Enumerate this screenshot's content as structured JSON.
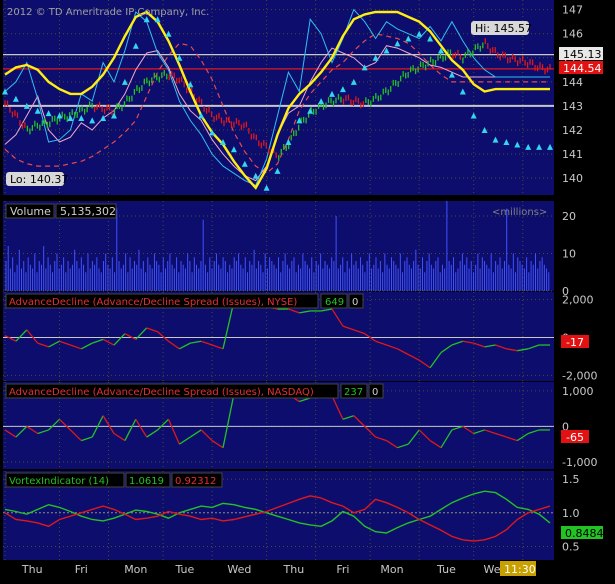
{
  "header": {
    "copyright": "2012 © TD Ameritrade IP Company, Inc."
  },
  "colors": {
    "panel_bg": "#0d0d6e",
    "grid": "#4a4a30",
    "price_up": "#22c322",
    "price_down": "#e01818",
    "markers": "#33d6ee",
    "band": "#e84a4a",
    "ma_yellow": "#ffee11",
    "cyan_line": "#30c0ee",
    "pink_line": "#f0a8c8",
    "volume": "#3f52ff",
    "hline": "#c8c8c8"
  },
  "x_axis": {
    "labels": [
      "Thu",
      "Fri",
      "Mon",
      "Tue",
      "Wed",
      "Thu",
      "Fri",
      "Mon",
      "Tue",
      "Wed"
    ],
    "current_time": "11:30"
  },
  "chart_data": [
    {
      "type": "line",
      "panel": "price",
      "y_ticks": [
        140,
        141,
        142,
        143,
        144,
        145,
        146,
        147
      ],
      "ylim": [
        139.3,
        147.4
      ],
      "annotations": {
        "high_label": "Hi: 145.57",
        "low_label": "Lo: 140.37",
        "last_price": "144.54",
        "marker_price": "145.13"
      },
      "reference_lines": [
        145.13,
        144.54,
        143.0
      ],
      "x": [
        0,
        2,
        4,
        6,
        8,
        10,
        12,
        14,
        16,
        18,
        20,
        22,
        24,
        26,
        28,
        30,
        32,
        34,
        36,
        38,
        40,
        42,
        44,
        46,
        48,
        50,
        52,
        54,
        56,
        58,
        60,
        62,
        64,
        66,
        68,
        70,
        72,
        74,
        76,
        78,
        80,
        82,
        84,
        86,
        88,
        90,
        92,
        94,
        96,
        98,
        100
      ],
      "series": [
        {
          "role": "price",
          "values": [
            143.1,
            142.6,
            142.0,
            142.2,
            142.3,
            142.5,
            142.6,
            142.8,
            143.0,
            142.9,
            142.8,
            143.1,
            143.6,
            144.0,
            144.2,
            144.3,
            144.1,
            143.6,
            143.1,
            142.6,
            142.4,
            142.3,
            142.2,
            141.6,
            141.3,
            140.9,
            141.4,
            142.2,
            142.7,
            143.0,
            143.2,
            143.3,
            143.2,
            143.1,
            143.3,
            143.6,
            144.0,
            144.4,
            144.6,
            144.8,
            145.0,
            145.2,
            145.0,
            145.3,
            145.6,
            145.2,
            145.0,
            144.9,
            144.8,
            144.6,
            144.5
          ]
        },
        {
          "role": "marker_upper",
          "values": [
            143.6,
            143.3,
            143.0,
            142.8,
            142.7,
            142.6,
            142.5,
            142.5,
            142.4,
            142.5,
            142.6,
            144.0,
            145.5,
            146.6,
            146.6,
            146.0,
            145.0,
            143.9,
            142.6,
            141.9,
            141.5,
            141.2,
            140.6,
            140.1,
            139.6,
            140.3,
            141.5,
            142.4,
            142.8,
            143.2,
            143.5,
            143.7,
            144.0,
            144.6,
            145.0,
            145.3,
            145.6,
            145.8,
            146.0,
            145.8,
            145.3,
            144.3,
            143.6,
            142.6,
            142.0,
            141.6,
            141.5,
            141.4,
            141.3,
            141.3,
            141.3
          ]
        },
        {
          "role": "yellow_line",
          "values": [
            144.3,
            144.6,
            144.7,
            144.5,
            144.0,
            143.7,
            143.5,
            143.5,
            143.8,
            144.3,
            145.0,
            145.9,
            146.7,
            146.9,
            146.5,
            145.7,
            144.7,
            143.6,
            142.6,
            141.9,
            141.4,
            140.7,
            140.1,
            139.6,
            140.4,
            141.8,
            142.9,
            143.5,
            143.9,
            144.4,
            145.0,
            145.9,
            146.6,
            146.8,
            146.9,
            146.9,
            146.9,
            146.7,
            146.5,
            146.1,
            145.5,
            144.9,
            144.5,
            143.9,
            143.6,
            143.7,
            143.7,
            143.7,
            143.7,
            143.7,
            143.7
          ]
        },
        {
          "role": "cyan_line",
          "values": [
            143.6,
            144.0,
            144.8,
            143.3,
            141.5,
            141.6,
            142.0,
            143.5,
            143.2,
            144.8,
            144.0,
            145.3,
            146.9,
            146.5,
            145.2,
            144.5,
            143.2,
            142.4,
            141.8,
            141.0,
            140.5,
            140.2,
            139.9,
            139.7,
            140.8,
            142.6,
            144.4,
            143.6,
            146.6,
            146.0,
            144.8,
            145.8,
            147.0,
            146.5,
            145.8,
            146.5,
            146.2,
            146.0,
            145.8,
            146.3,
            145.7,
            146.5,
            145.7,
            145.0,
            144.5,
            144.2,
            144.2,
            144.2,
            144.2,
            144.2,
            144.2
          ]
        },
        {
          "role": "pink_line",
          "values": [
            141.4,
            141.8,
            142.6,
            143.4,
            142.0,
            141.5,
            141.7,
            142.3,
            142.0,
            142.5,
            142.8,
            143.5,
            144.5,
            145.2,
            145.3,
            144.6,
            143.5,
            142.8,
            142.4,
            141.6,
            141.0,
            140.5,
            140.1,
            139.9,
            140.5,
            141.8,
            142.7,
            143.0,
            144.0,
            144.8,
            145.4,
            145.2,
            145.0,
            144.6,
            144.8,
            145.5,
            145.4,
            145.2,
            145.0,
            144.7,
            144.6,
            144.4,
            144.2,
            144.2,
            144.2,
            144.2,
            144.2,
            144.2,
            144.2,
            144.2,
            144.2
          ]
        },
        {
          "role": "red_dashed_band",
          "values": [
            141.2,
            140.8,
            140.6,
            140.5,
            140.5,
            140.5,
            140.6,
            140.7,
            140.9,
            141.2,
            141.5,
            141.9,
            142.4,
            143.4,
            144.4,
            145.1,
            145.6,
            145.5,
            144.9,
            144.1,
            143.0,
            141.9,
            141.1,
            140.5,
            140.2,
            140.6,
            141.6,
            142.8,
            143.5,
            144.0,
            144.5,
            144.8,
            145.3,
            145.7,
            146.0,
            145.9,
            145.8,
            145.6,
            145.2,
            144.7,
            144.3,
            144.0,
            144.0,
            144.0,
            144.0,
            144.0,
            144.0,
            144.0,
            144.0,
            144.0,
            144.0
          ]
        }
      ]
    },
    {
      "type": "bar",
      "panel": "volume",
      "title": "Volume",
      "current_value": "5,135,302",
      "unit_label": "<millions>",
      "y_ticks": [
        0,
        10,
        20
      ],
      "ylim": [
        0,
        24
      ],
      "values": [
        8,
        12,
        6,
        9,
        5,
        7,
        11,
        6,
        8,
        5,
        9,
        7,
        6,
        10,
        5,
        8,
        7,
        12,
        6,
        9,
        7,
        5,
        8,
        10,
        6,
        7,
        9,
        5,
        8,
        6,
        7,
        11,
        8,
        6,
        9,
        7,
        5,
        10,
        6,
        8,
        7,
        9,
        6,
        5,
        8,
        10,
        7,
        6,
        9,
        5,
        22,
        8,
        6,
        7,
        10,
        5,
        9,
        6,
        8,
        7,
        11,
        6,
        8,
        5,
        9,
        7,
        6,
        10,
        8,
        7,
        5,
        9,
        6,
        8,
        10,
        7,
        6,
        9,
        5,
        8,
        7,
        6,
        10,
        8,
        5,
        9,
        7,
        6,
        8,
        19,
        7,
        5,
        9,
        6,
        8,
        10,
        7,
        6,
        9,
        8,
        5,
        7,
        6,
        9,
        8,
        10,
        7,
        6,
        9,
        5,
        8,
        7,
        11,
        6,
        8,
        7,
        5,
        10,
        6,
        9,
        8,
        7,
        6,
        9,
        5,
        8,
        10,
        7,
        6,
        8,
        9,
        5,
        7,
        6,
        10,
        8,
        7,
        6,
        9,
        5,
        8,
        7,
        10,
        6,
        8,
        7,
        6,
        9,
        8,
        20,
        6,
        7,
        9,
        5,
        8,
        6,
        10,
        7,
        8,
        6,
        9,
        7,
        5,
        8,
        10,
        6,
        7,
        9,
        6,
        8,
        5,
        10,
        7,
        6,
        9,
        8,
        7,
        6,
        10,
        5,
        8,
        9,
        7,
        6,
        8,
        11,
        7,
        6,
        9,
        5,
        8,
        10,
        7,
        6,
        8,
        9,
        5,
        7,
        6,
        24,
        8,
        7,
        9,
        5,
        6,
        8,
        10,
        7,
        9,
        6,
        8,
        5,
        7,
        10,
        6,
        9,
        8,
        7,
        6,
        10,
        5,
        8,
        7,
        9,
        6,
        8,
        22,
        7,
        6,
        10,
        5,
        9,
        8,
        7,
        6,
        9,
        5,
        8,
        7,
        10,
        6,
        8,
        9,
        7,
        6,
        5
      ]
    },
    {
      "type": "line",
      "panel": "nyse",
      "title": "AdvanceDecline (Advance/Decline Spread (Issues), NYSE)",
      "value_a": "649",
      "value_b": "0",
      "last_label": "-17",
      "y_ticks": [
        -2000,
        0,
        2000
      ],
      "ylim": [
        -2300,
        2400
      ],
      "x": [
        0,
        2,
        4,
        6,
        8,
        10,
        12,
        14,
        16,
        18,
        20,
        22,
        24,
        26,
        28,
        30,
        32,
        34,
        36,
        38,
        40,
        42,
        44,
        46,
        48,
        50,
        52,
        54,
        56,
        58,
        60,
        62,
        64,
        66,
        68,
        70,
        72,
        74,
        76,
        78,
        80,
        82,
        84,
        86,
        88,
        90,
        92,
        94,
        96,
        98,
        100
      ],
      "values": [
        100,
        -200,
        400,
        -300,
        -500,
        -200,
        -400,
        -600,
        -300,
        -100,
        -400,
        200,
        -100,
        500,
        300,
        -200,
        -600,
        -300,
        -200,
        -400,
        -600,
        1900,
        2000,
        1700,
        1600,
        1500,
        1500,
        1300,
        1400,
        1400,
        1500,
        600,
        400,
        200,
        -200,
        -400,
        -600,
        -900,
        -1200,
        -1600,
        -800,
        -400,
        -200,
        -300,
        -500,
        -400,
        -600,
        -700,
        -600,
        -400,
        -400
      ]
    },
    {
      "type": "line",
      "panel": "nasdaq",
      "title": "AdvanceDecline (Advance/Decline Spread (Issues), NASDAQ)",
      "value_a": "237",
      "value_b": "0",
      "last_label": "-65",
      "y_ticks": [
        -1000,
        0,
        1000
      ],
      "ylim": [
        -1200,
        1250
      ],
      "x": [
        0,
        2,
        4,
        6,
        8,
        10,
        12,
        14,
        16,
        18,
        20,
        22,
        24,
        26,
        28,
        30,
        32,
        34,
        36,
        38,
        40,
        42,
        44,
        46,
        48,
        50,
        52,
        54,
        56,
        58,
        60,
        62,
        64,
        66,
        68,
        70,
        72,
        74,
        76,
        78,
        80,
        82,
        84,
        86,
        88,
        90,
        92,
        94,
        96,
        98,
        100
      ],
      "values": [
        -100,
        -300,
        0,
        -200,
        -100,
        200,
        -100,
        -400,
        -300,
        300,
        -200,
        -400,
        200,
        -300,
        -100,
        200,
        -500,
        -300,
        -100,
        -400,
        -600,
        900,
        1000,
        950,
        900,
        880,
        900,
        700,
        800,
        900,
        860,
        200,
        300,
        0,
        -300,
        -400,
        -600,
        -500,
        -100,
        -400,
        -600,
        -100,
        0,
        -200,
        -100,
        -200,
        -300,
        -400,
        -200,
        -100,
        -100
      ]
    },
    {
      "type": "line",
      "panel": "vortex",
      "title": "VortexIndicator (14)",
      "vi_plus": "1.0619",
      "vi_minus": "0.92312",
      "last_label": "0.8484",
      "y_ticks": [
        0.5,
        1.0,
        1.5
      ],
      "ylim": [
        0.3,
        1.62
      ],
      "x": [
        0,
        2,
        4,
        6,
        8,
        10,
        12,
        14,
        16,
        18,
        20,
        22,
        24,
        26,
        28,
        30,
        32,
        34,
        36,
        38,
        40,
        42,
        44,
        46,
        48,
        50,
        52,
        54,
        56,
        58,
        60,
        62,
        64,
        66,
        68,
        70,
        72,
        74,
        76,
        78,
        80,
        82,
        84,
        86,
        88,
        90,
        92,
        94,
        96,
        98,
        100
      ],
      "series": [
        {
          "color_key": "price_up",
          "values": [
            1.05,
            1.02,
            0.98,
            1.05,
            1.12,
            1.08,
            1.02,
            0.95,
            0.9,
            0.88,
            0.92,
            0.98,
            1.04,
            1.02,
            0.98,
            0.92,
            1.0,
            1.05,
            1.1,
            1.08,
            1.14,
            1.12,
            1.08,
            1.05,
            1.0,
            0.95,
            0.9,
            0.85,
            0.82,
            0.8,
            0.88,
            1.02,
            0.95,
            0.8,
            0.72,
            0.7,
            0.78,
            0.85,
            0.9,
            0.95,
            1.05,
            1.15,
            1.22,
            1.28,
            1.32,
            1.3,
            1.2,
            1.08,
            1.05,
            0.98,
            0.85
          ]
        },
        {
          "color_key": "price_down",
          "values": [
            1.0,
            0.9,
            0.88,
            0.85,
            0.8,
            0.9,
            0.95,
            1.0,
            1.05,
            1.1,
            1.05,
            0.98,
            0.9,
            0.92,
            0.95,
            1.02,
            0.98,
            0.95,
            0.9,
            0.92,
            0.88,
            0.9,
            0.94,
            0.98,
            1.02,
            1.08,
            1.14,
            1.2,
            1.25,
            1.22,
            1.15,
            1.1,
            1.0,
            1.05,
            1.2,
            1.15,
            1.08,
            1.0,
            0.9,
            0.82,
            0.74,
            0.65,
            0.6,
            0.58,
            0.6,
            0.65,
            0.75,
            0.9,
            1.0,
            1.05,
            1.1
          ]
        }
      ]
    }
  ]
}
